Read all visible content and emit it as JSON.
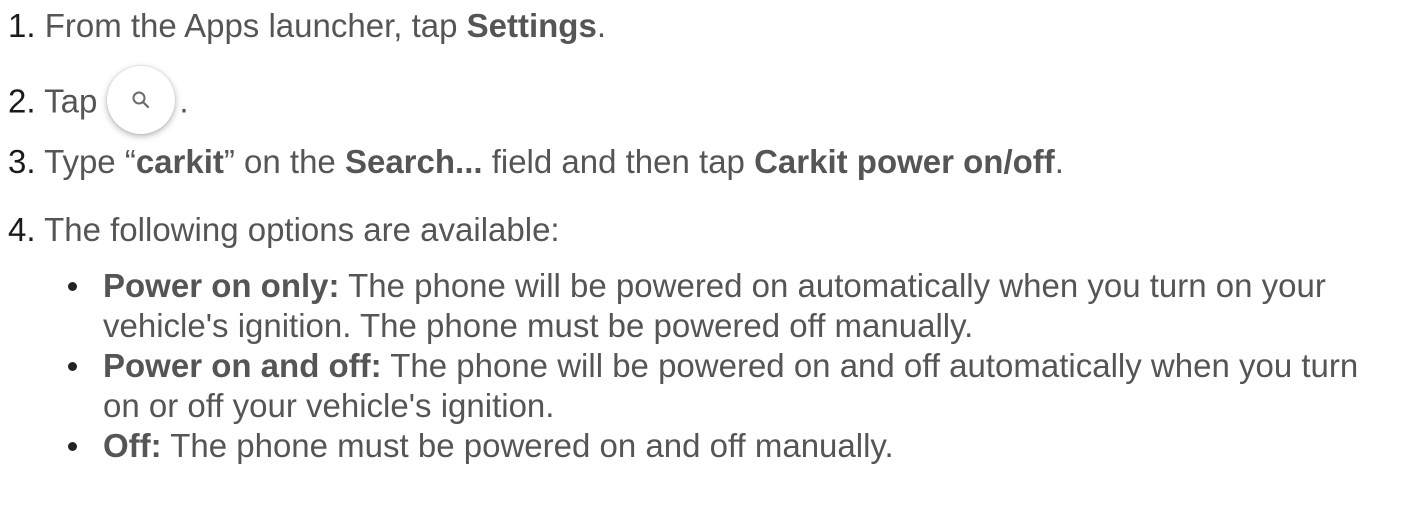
{
  "steps": [
    {
      "num": "1.",
      "pre": "From the Apps launcher, tap ",
      "bold": "Settings",
      "post": "."
    },
    {
      "num": "2.",
      "pre": "Tap",
      "icon": "search-icon",
      "post": "."
    },
    {
      "num": "3.",
      "t1": "Type “",
      "b1": "carkit",
      "t2": "” on the ",
      "b2": "Search...",
      "t3": " field and then tap ",
      "b3": "Carkit power on/off",
      "t4": "."
    },
    {
      "num": "4.",
      "text": "The following options are available:"
    }
  ],
  "options": [
    {
      "label": "Power on only:",
      "text": " The phone will be powered on automatically when you turn on your vehicle's ignition. The phone must be powered off manually."
    },
    {
      "label": "Power on and off:",
      "text": " The phone will be powered on and off automatically when you turn on or off your vehicle's ignition."
    },
    {
      "label": "Off:",
      "text": " The phone must be powered on and off manually."
    }
  ]
}
